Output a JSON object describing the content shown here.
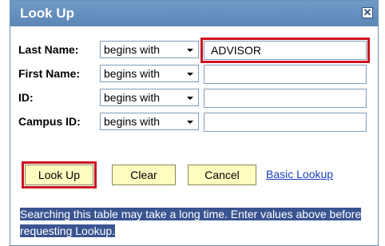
{
  "dialog": {
    "title": "Look Up",
    "close_glyph": "✕"
  },
  "fields": [
    {
      "label": "Last Name:",
      "operator": "begins with",
      "value": "ADVISOR"
    },
    {
      "label": "First Name:",
      "operator": "begins with",
      "value": ""
    },
    {
      "label": "ID:",
      "operator": "begins with",
      "value": ""
    },
    {
      "label": "Campus ID:",
      "operator": "begins with",
      "value": ""
    }
  ],
  "buttons": {
    "lookup": "Look Up",
    "clear": "Clear",
    "cancel": "Cancel",
    "basic_lookup": "Basic Lookup"
  },
  "message": "Searching this table may take a long time. Enter values above before requesting Lookup.",
  "colors": {
    "titlebar": "#5b86b5",
    "button_bg": "#fffcc0",
    "highlight": "#cc1020",
    "message_bg": "#3a5490",
    "link": "#1a3fbf"
  }
}
